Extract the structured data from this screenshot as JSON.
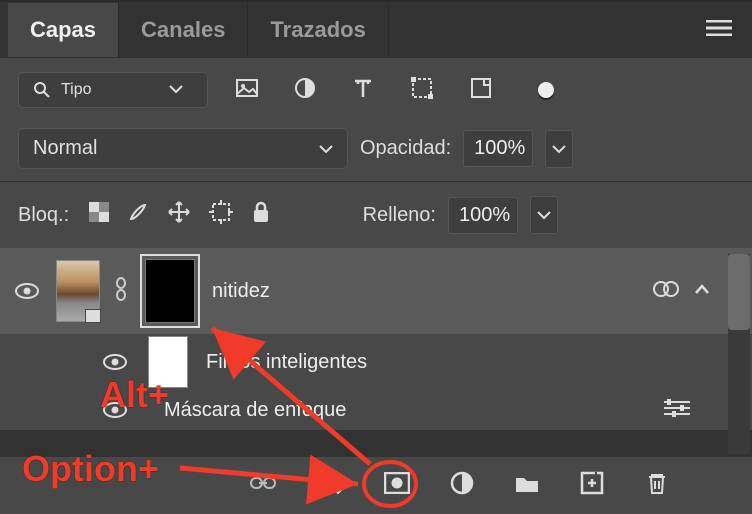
{
  "tabs": {
    "layers": "Capas",
    "channels": "Canales",
    "paths": "Trazados"
  },
  "filter_select": {
    "label": "Tipo"
  },
  "blend": {
    "mode": "Normal",
    "opacity_label": "Opacidad:",
    "opacity_value": "100%"
  },
  "lock": {
    "label": "Bloq.:",
    "fill_label": "Relleno:",
    "fill_value": "100%"
  },
  "layers": {
    "main": {
      "name": "nitidez"
    },
    "smart_filters_label": "Filtros inteligentes",
    "filter_item": "Máscara de enfoque"
  },
  "annotations": {
    "alt": "Alt+",
    "option": "Option+"
  }
}
